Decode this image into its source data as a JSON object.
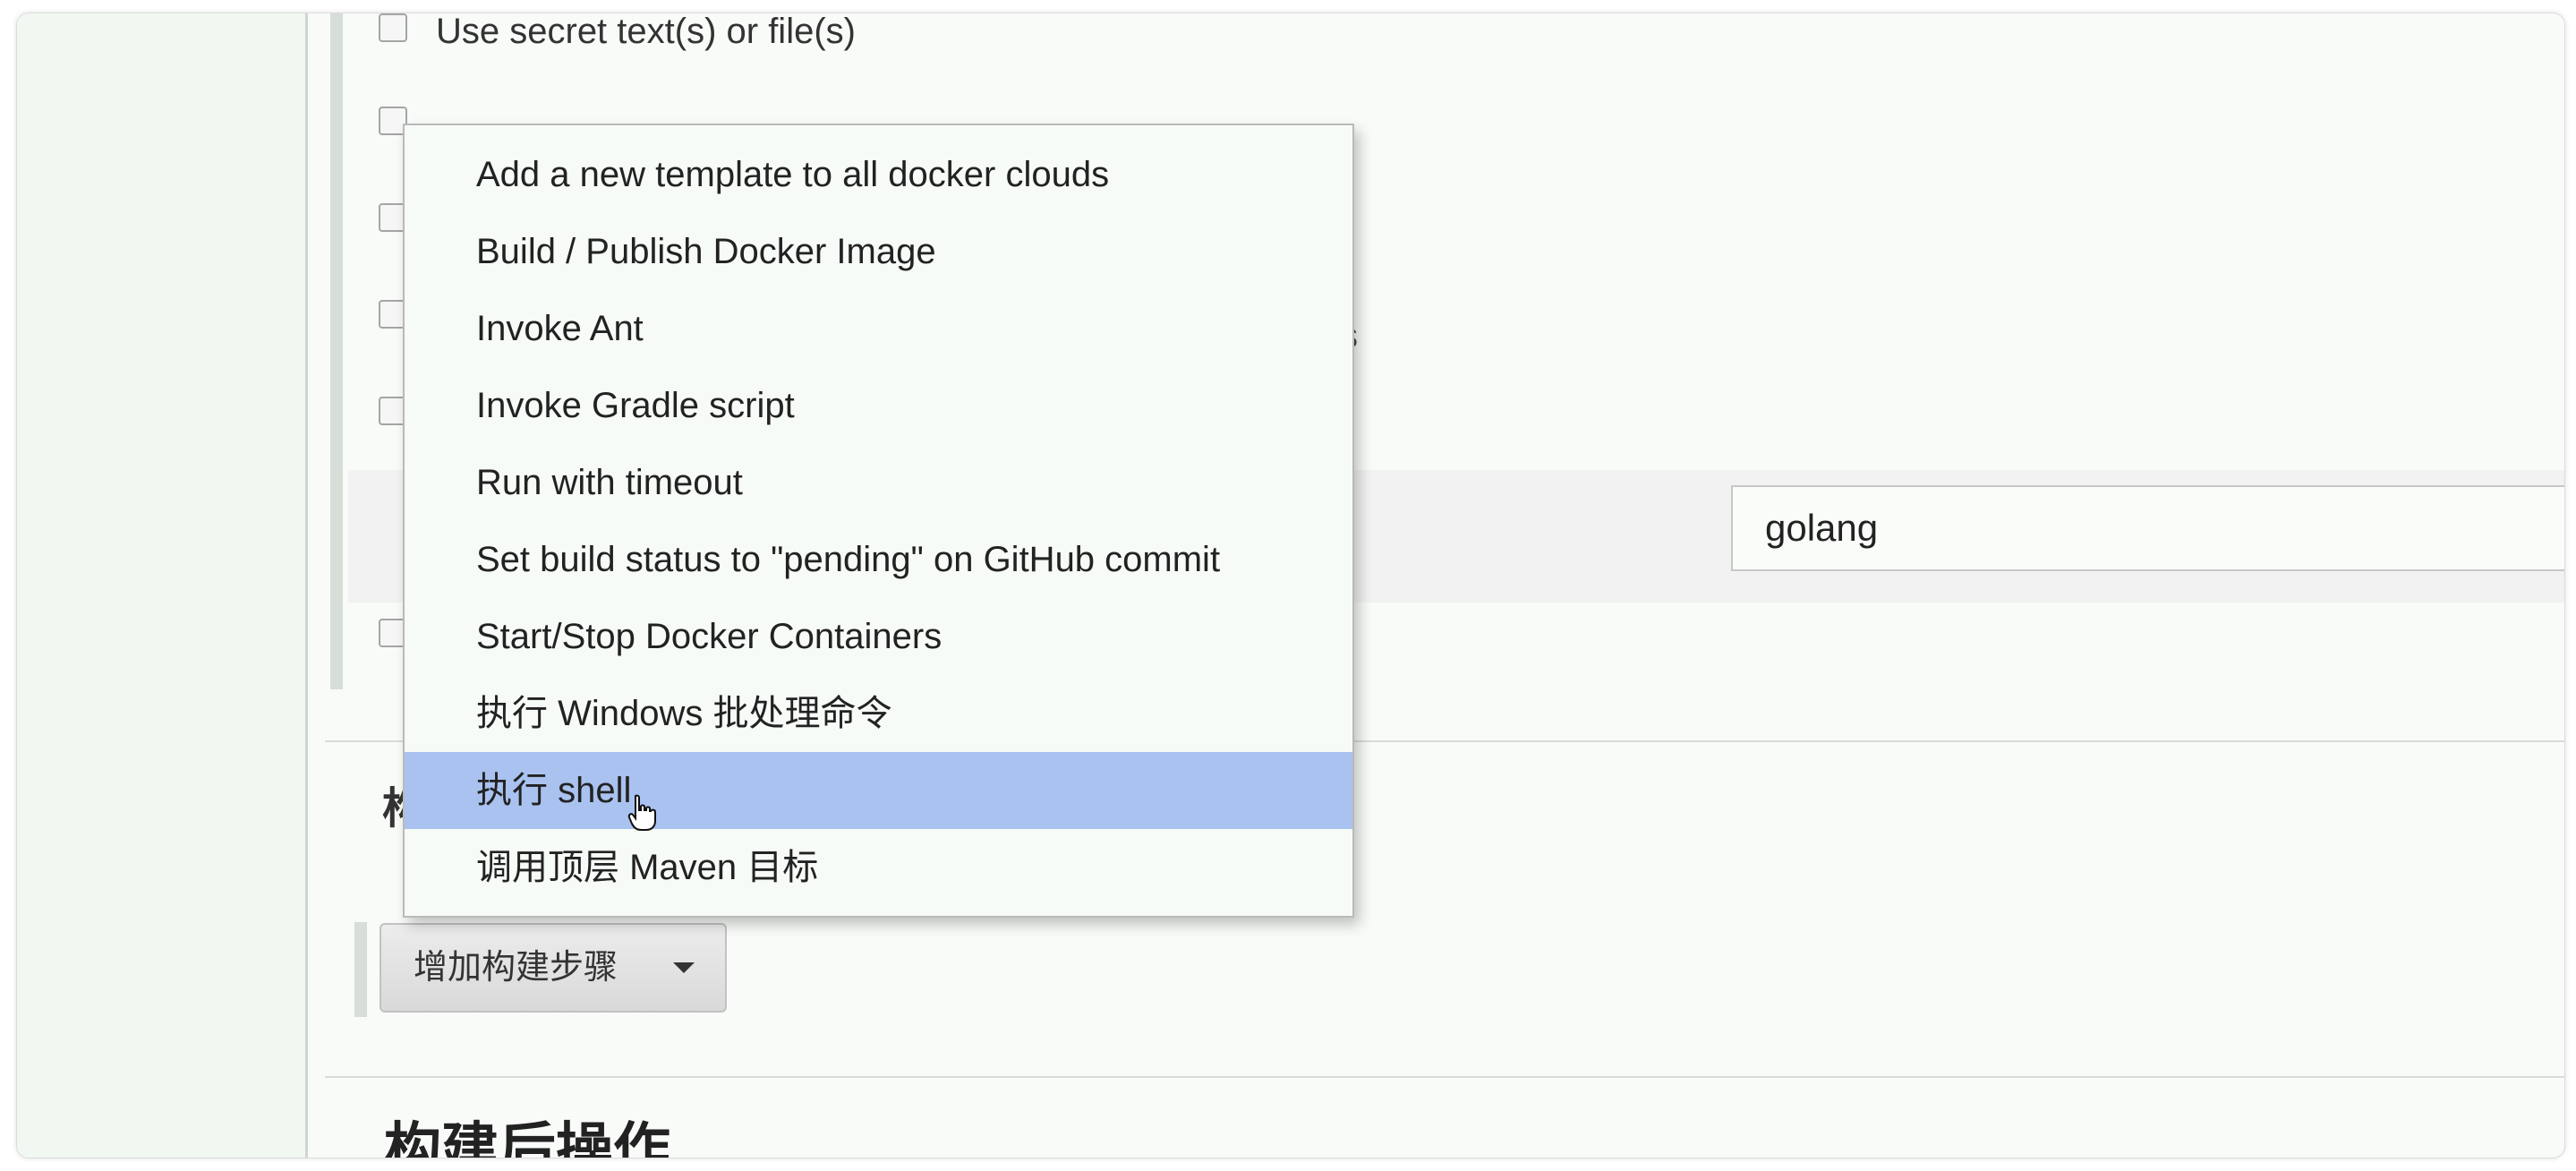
{
  "options": {
    "use_secret": "Use secret text(s) or file(s)"
  },
  "clipped_text": "s",
  "input": {
    "value": "golang"
  },
  "dropdown": {
    "items": [
      "Add a new template to all docker clouds",
      "Build / Publish Docker Image",
      "Invoke Ant",
      "Invoke Gradle script",
      "Run with timeout",
      "Set build status to \"pending\" on GitHub commit",
      "Start/Stop Docker Containers",
      "执行 Windows 批处理命令",
      "执行 shell",
      "调用顶层 Maven 目标"
    ],
    "selected_index": 8
  },
  "partial_heading": "构",
  "buttons": {
    "add_build_step": "增加构建步骤"
  },
  "sections": {
    "post_build": "构建后操作"
  },
  "colors": {
    "selection": "#a9c2ef",
    "background": "#f8fbf8"
  }
}
